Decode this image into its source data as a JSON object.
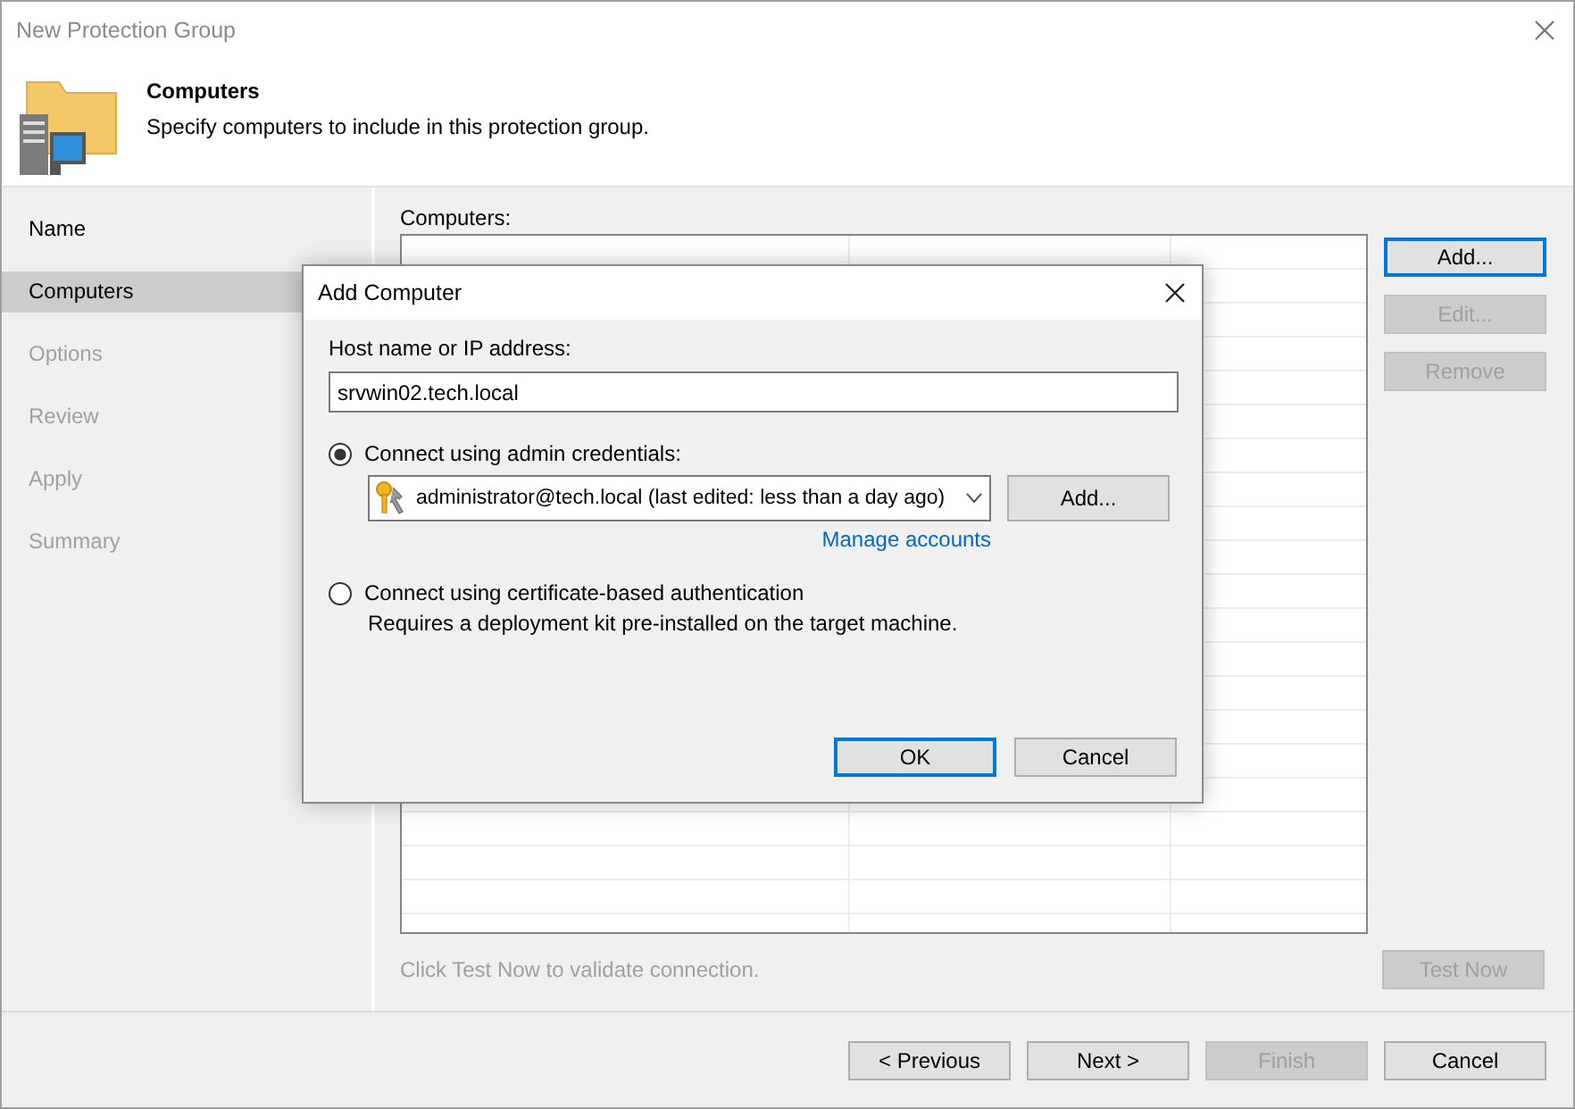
{
  "window": {
    "title": "New Protection Group"
  },
  "header": {
    "title": "Computers",
    "subtitle": "Specify computers to include in this protection group."
  },
  "steps": [
    {
      "label": "Name",
      "selected": false,
      "disabled": false
    },
    {
      "label": "Computers",
      "selected": true,
      "disabled": false
    },
    {
      "label": "Options",
      "selected": false,
      "disabled": true
    },
    {
      "label": "Review",
      "selected": false,
      "disabled": true
    },
    {
      "label": "Apply",
      "selected": false,
      "disabled": true
    },
    {
      "label": "Summary",
      "selected": false,
      "disabled": true
    }
  ],
  "computers": {
    "label": "Computers:",
    "buttons": [
      {
        "label": "Add...",
        "disabled": false,
        "default": true
      },
      {
        "label": "Edit...",
        "disabled": true,
        "default": false
      },
      {
        "label": "Remove",
        "disabled": true,
        "default": false
      }
    ]
  },
  "hint": "Click Test Now to validate connection.",
  "test_button": {
    "label": "Test Now",
    "disabled": true
  },
  "footer_buttons": [
    {
      "label": "< Previous",
      "disabled": false
    },
    {
      "label": "Next >",
      "disabled": false
    },
    {
      "label": "Finish",
      "disabled": true
    },
    {
      "label": "Cancel",
      "disabled": false
    }
  ],
  "dialog": {
    "title": "Add Computer",
    "host_label": "Host name or IP address:",
    "host_value": "srvwin02.tech.local",
    "options": [
      {
        "label": "Connect using admin credentials:",
        "selected": true
      },
      {
        "label": "Connect using certificate-based authentication",
        "selected": false
      }
    ],
    "account": "administrator@tech.local (last edited: less than a day ago)",
    "add_button": "Add...",
    "link": "Manage accounts",
    "description": "Requires a deployment kit pre-installed on the target machine.",
    "buttons": [
      {
        "label": "OK",
        "default": true
      },
      {
        "label": "Cancel",
        "default": false
      }
    ]
  }
}
